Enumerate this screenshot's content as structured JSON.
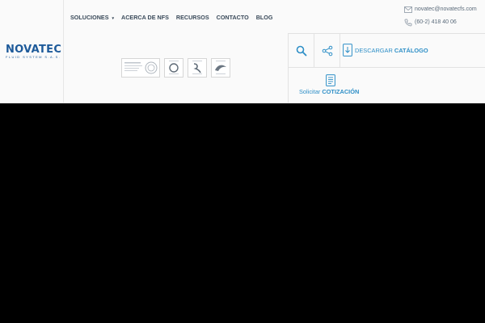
{
  "brand": {
    "name": "NOVATEC",
    "tagline": "FLUID SYSTEM S.A.S."
  },
  "nav": {
    "items": [
      {
        "label": "Soluciones",
        "has_dropdown": true
      },
      {
        "label": "Acerca de NFS",
        "has_dropdown": false
      },
      {
        "label": "Recursos",
        "has_dropdown": false
      },
      {
        "label": "Contacto",
        "has_dropdown": false
      },
      {
        "label": "Blog",
        "has_dropdown": false
      }
    ],
    "caret": "▾"
  },
  "contact": {
    "email": "novatec@novatecfs.com",
    "phone": "(60-2) 418 40 06"
  },
  "actions": {
    "download_prefix": "DESCARGAR ",
    "download_bold": "CATÁLOGO",
    "quote_prefix": "Solicitar ",
    "quote_bold": "COTIZACIÓN"
  },
  "icons": [
    "logo",
    "envelope-icon",
    "phone-icon",
    "search-icon",
    "share-icon",
    "download-icon",
    "quote-form-icon"
  ],
  "colors": {
    "accent": "#2e8fc7",
    "brand": "#1d5a9a",
    "header_bg": "#fafafa",
    "page_bg": "#000000",
    "nav_text": "#3a4a5a"
  }
}
